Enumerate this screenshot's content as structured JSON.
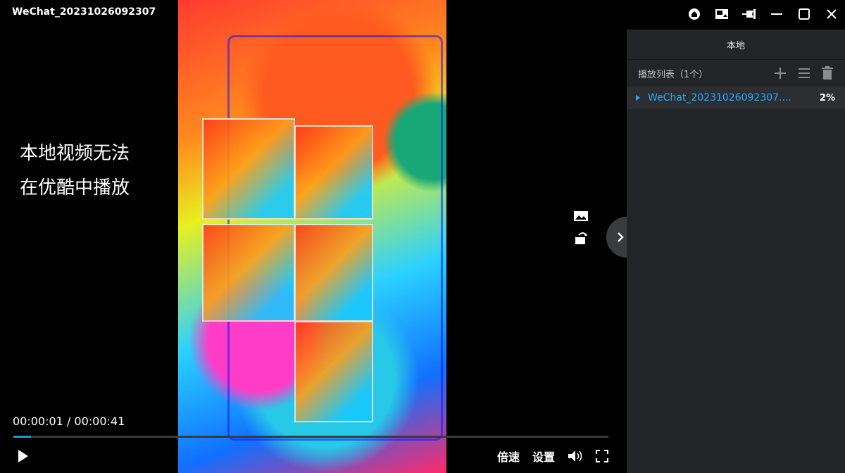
{
  "window": {
    "title": "WeChat_20231026092307"
  },
  "icons": {
    "home": "home-icon",
    "pip": "picture-in-picture-icon",
    "pin": "pin-icon",
    "minimize": "minimize-icon",
    "maximize": "maximize-icon",
    "close": "close-icon"
  },
  "overlay": {
    "line1": "本地视频无法",
    "line2": "在优酷中播放"
  },
  "player": {
    "current_time": "00:00:01",
    "separator": " / ",
    "total_time": "00:00:41",
    "progress": 0.03,
    "speed_label": "倍速",
    "settings_label": "设置"
  },
  "sidebar": {
    "header": "本地",
    "playlist_title": "播放列表（1个）",
    "items": [
      {
        "name": "WeChat_20231026092307....",
        "percent": "2%"
      }
    ]
  },
  "colors": {
    "accent": "#1d9bd7",
    "sidebar_bg": "#232427",
    "item_text": "#2aa8ff"
  }
}
